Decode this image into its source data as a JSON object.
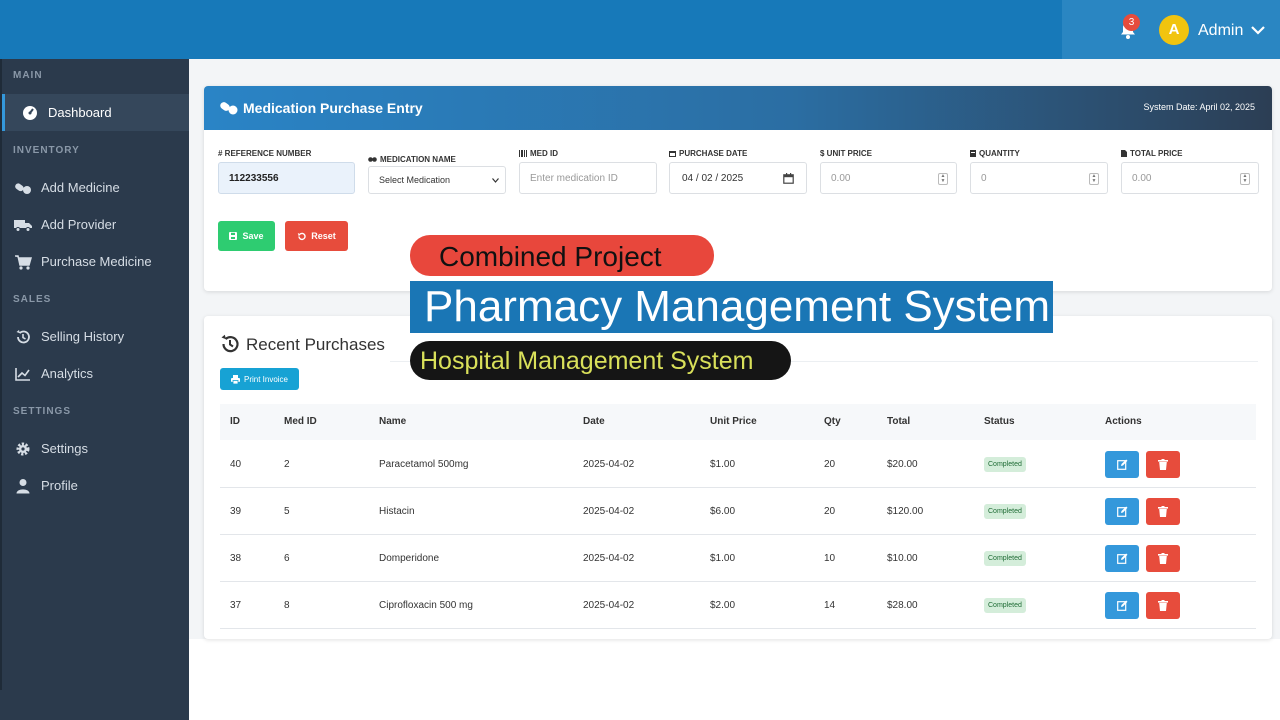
{
  "topbar": {
    "notification_count": "3",
    "avatar_initial": "A",
    "user_name": "Admin"
  },
  "sidebar": {
    "sections": {
      "main": "MAIN",
      "inventory": "INVENTORY",
      "sales": "SALES",
      "settings": "SETTINGS"
    },
    "items": {
      "dashboard": "Dashboard",
      "add_medicine": "Add Medicine",
      "add_provider": "Add Provider",
      "purchase_medicine": "Purchase Medicine",
      "selling_history": "Selling History",
      "analytics": "Analytics",
      "settings": "Settings",
      "profile": "Profile"
    }
  },
  "purchase_form": {
    "title": "Medication Purchase Entry",
    "system_date": "System Date: April 02, 2025",
    "fields": {
      "reference_label": "# REFERENCE NUMBER",
      "reference_value": "112233556",
      "medication_label": "MEDICATION NAME",
      "medication_value": "Select Medication",
      "medid_label": "MED ID",
      "medid_placeholder": "Enter medication ID",
      "date_label": "PURCHASE DATE",
      "date_value": "04 / 02 / 2025",
      "unit_price_label": "$ UNIT PRICE",
      "unit_price_placeholder": "0.00",
      "quantity_label": "QUANTITY",
      "quantity_placeholder": "0",
      "total_label": "TOTAL PRICE",
      "total_placeholder": "0.00"
    },
    "save_label": "Save",
    "reset_label": "Reset"
  },
  "recent": {
    "title": "Recent Purchases",
    "print_label": "Print Invoice",
    "columns": [
      "ID",
      "Med ID",
      "Name",
      "Date",
      "Unit Price",
      "Qty",
      "Total",
      "Status",
      "Actions"
    ],
    "rows": [
      {
        "id": "40",
        "med_id": "2",
        "name": "Paracetamol 500mg",
        "date": "2025-04-02",
        "unit_price": "$1.00",
        "qty": "20",
        "total": "$20.00",
        "status": "Completed"
      },
      {
        "id": "39",
        "med_id": "5",
        "name": "Histacin",
        "date": "2025-04-02",
        "unit_price": "$6.00",
        "qty": "20",
        "total": "$120.00",
        "status": "Completed"
      },
      {
        "id": "38",
        "med_id": "6",
        "name": "Domperidone",
        "date": "2025-04-02",
        "unit_price": "$1.00",
        "qty": "10",
        "total": "$10.00",
        "status": "Completed"
      },
      {
        "id": "37",
        "med_id": "8",
        "name": "Ciprofloxacin 500 mg",
        "date": "2025-04-02",
        "unit_price": "$2.00",
        "qty": "14",
        "total": "$28.00",
        "status": "Completed"
      }
    ]
  },
  "overlay": {
    "line1": "Combined Project",
    "line2": "Pharmacy Management System",
    "line3": "Hospital Management System"
  },
  "colors": {
    "topbar": "#1779b9",
    "sidebar": "#2b3a4c",
    "save": "#2ecc71",
    "danger": "#e74c3c",
    "edit": "#3498db",
    "print": "#17a2d4",
    "badge_bg": "#d4edda"
  }
}
